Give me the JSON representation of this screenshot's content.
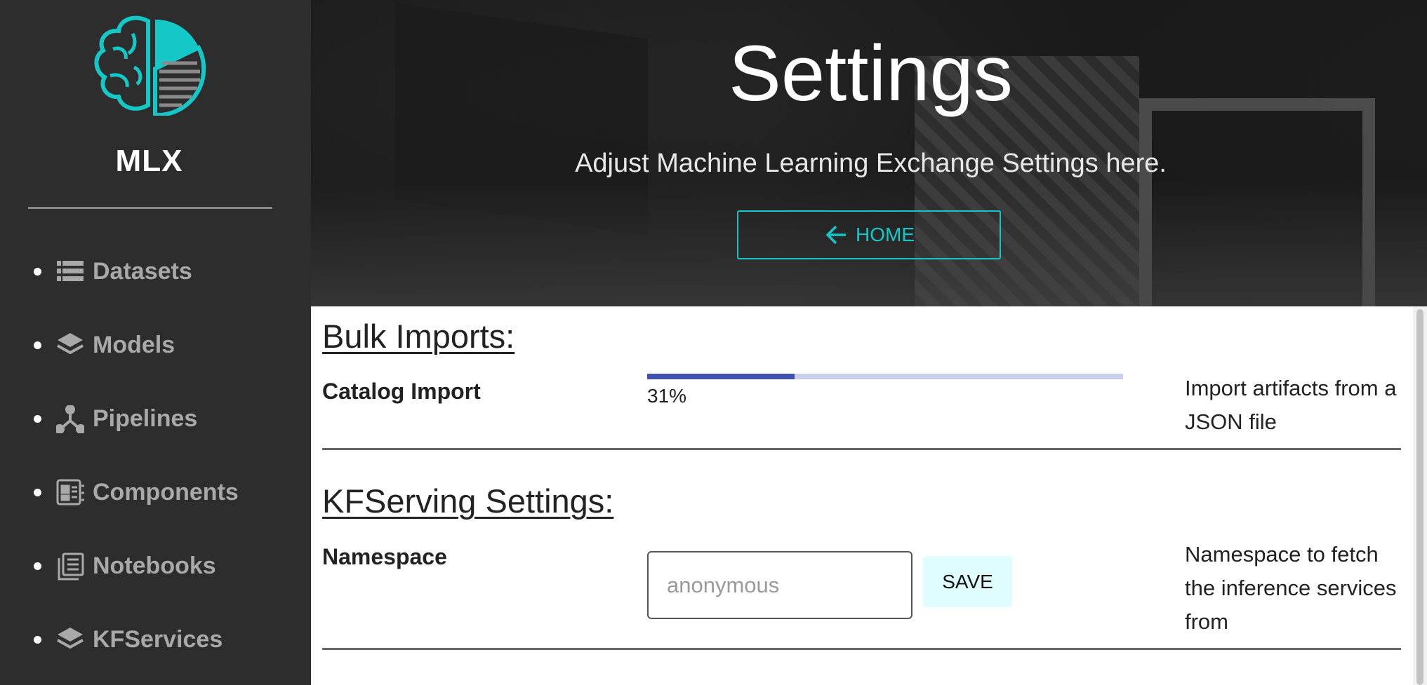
{
  "brand": {
    "name": "MLX",
    "logo_icon": "brain-chart-logo-icon",
    "accent": "#14c8c8"
  },
  "sidebar": {
    "items": [
      {
        "label": "Datasets",
        "icon": "database-list-icon"
      },
      {
        "label": "Models",
        "icon": "layers-icon"
      },
      {
        "label": "Pipelines",
        "icon": "fork-icon"
      },
      {
        "label": "Components",
        "icon": "component-panel-icon"
      },
      {
        "label": "Notebooks",
        "icon": "notebook-icon"
      },
      {
        "label": "KFServices",
        "icon": "layers-icon"
      }
    ]
  },
  "hero": {
    "title": "Settings",
    "subtitle": "Adjust Machine Learning Exchange Settings here.",
    "home_button": "HOME"
  },
  "bulk_imports": {
    "title": "Bulk Imports:",
    "catalog_label": "Catalog Import",
    "progress_percent": 31,
    "progress_text": "31%",
    "description": "Import artifacts from a JSON file"
  },
  "kfserving": {
    "title": "KFServing Settings:",
    "namespace_label": "Namespace",
    "namespace_placeholder": "anonymous",
    "save_button": "SAVE",
    "description": "Namespace to fetch the inference services from"
  },
  "colors": {
    "sidebar_bg": "#2d2d2d",
    "accent": "#14c8c8",
    "progress_fill": "#3f51b5",
    "progress_track": "#c9cfea",
    "save_bg": "#e0fdfd"
  }
}
